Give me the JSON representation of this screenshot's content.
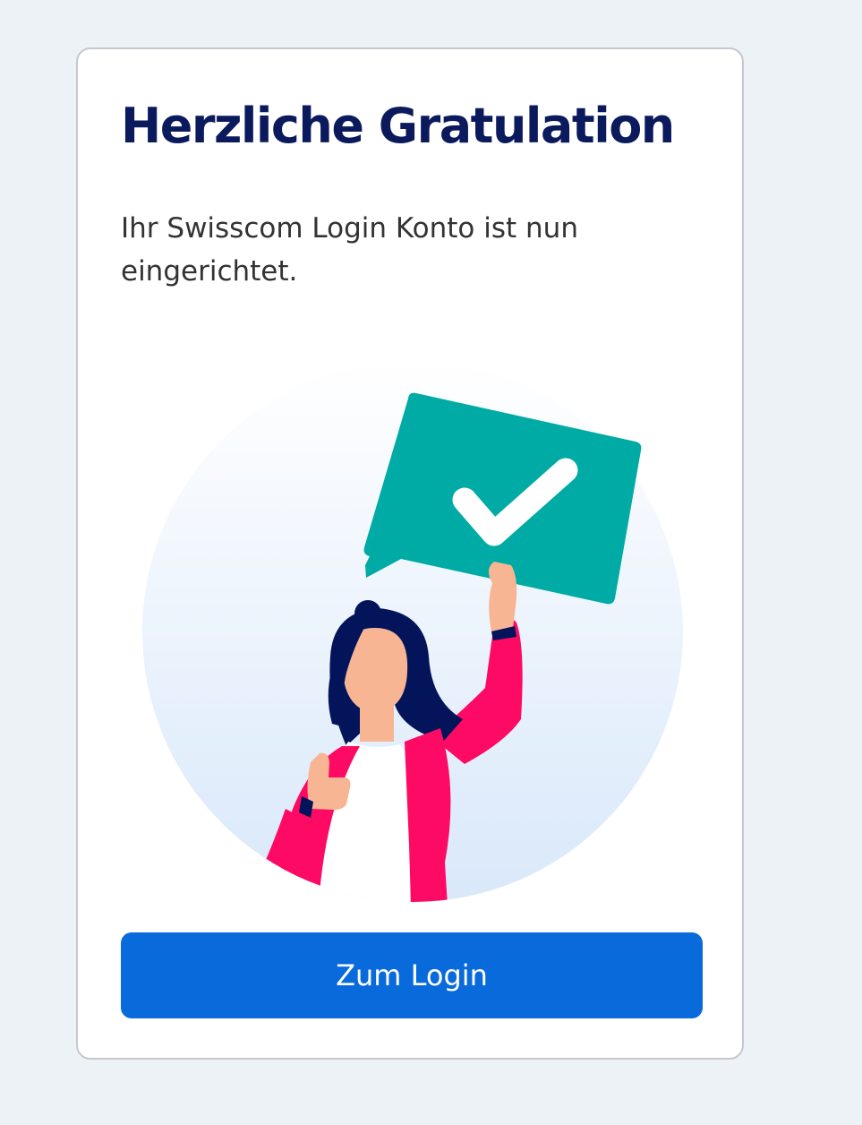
{
  "card": {
    "title": "Herzliche Gratulation",
    "message": "Ihr Swisscom Login Konto ist nun eingerichtet.",
    "button_label": "Zum Login"
  },
  "illustration": {
    "icon": "success-checkmark-speech-bubble",
    "colors": {
      "bubble": "#00aba5",
      "checkmark": "#ffffff",
      "jacket": "#fd0a64",
      "hair": "#03145a",
      "skin": "#f7b593",
      "pants": "#5e46c0",
      "circle_gradient_bottom": "#d9e8fa"
    }
  },
  "colors": {
    "page_background": "#edf2f7",
    "title": "#0a1a5c",
    "button": "#086adb",
    "card_border": "#c5c9cf"
  }
}
